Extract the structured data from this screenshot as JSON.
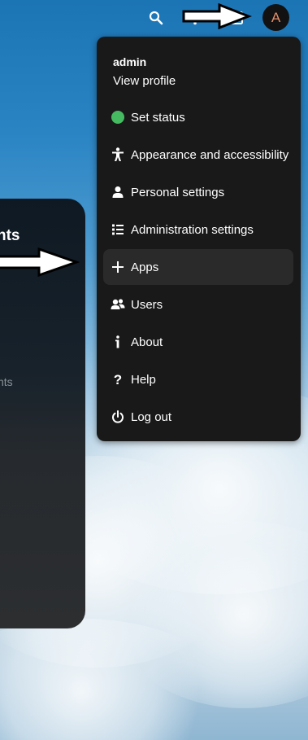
{
  "header": {
    "icons": [
      "search-icon",
      "notifications-icon",
      "contacts-icon"
    ],
    "avatar_letter": "A",
    "avatar_letter_color": "#e08f6a"
  },
  "dashboard_panel": {
    "title_fragment": "nts",
    "subtitle_fragment": "nts"
  },
  "user_menu": {
    "username": "admin",
    "view_profile": "View profile",
    "items": [
      {
        "label": "Set status",
        "icon": "status-dot-icon",
        "status_color": "#46ba61"
      },
      {
        "label": "Appearance and accessibility",
        "icon": "accessibility-icon"
      },
      {
        "label": "Personal settings",
        "icon": "person-icon"
      },
      {
        "label": "Administration settings",
        "icon": "list-icon"
      },
      {
        "label": "Apps",
        "icon": "plus-icon",
        "highlighted": true
      },
      {
        "label": "Users",
        "icon": "users-icon"
      },
      {
        "label": "About",
        "icon": "info-icon"
      },
      {
        "label": "Help",
        "icon": "help-icon"
      },
      {
        "label": "Log out",
        "icon": "power-icon"
      }
    ]
  },
  "colors": {
    "menu_bg": "#191919",
    "highlight_bg": "#2a2a2a",
    "sky_blue": "#1b74b4"
  }
}
